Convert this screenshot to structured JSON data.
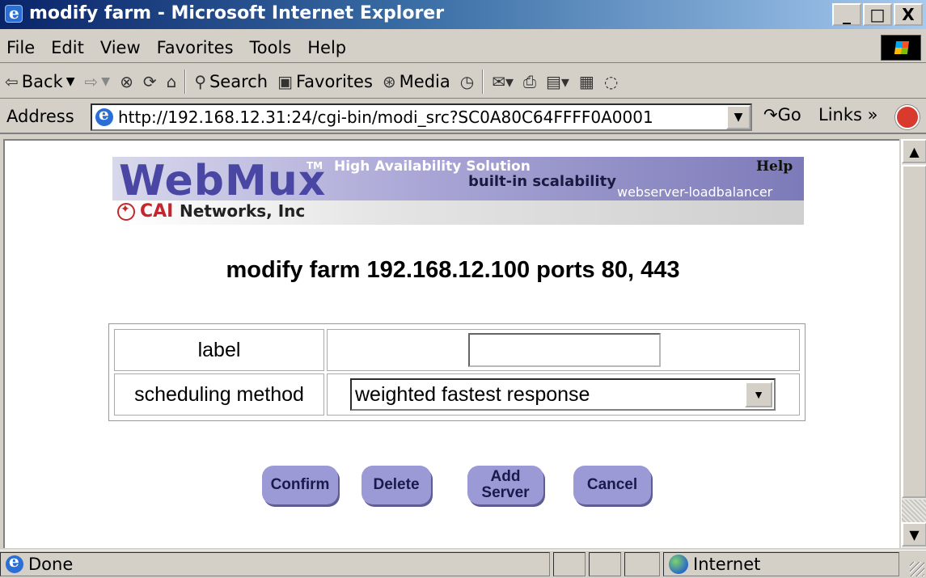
{
  "window": {
    "title": "modify farm - Microsoft Internet Explorer",
    "controls": {
      "minimize": "_",
      "maximize": "□",
      "close": "X"
    }
  },
  "menu": [
    "File",
    "Edit",
    "View",
    "Favorites",
    "Tools",
    "Help"
  ],
  "toolbar": {
    "back": "Back",
    "search": "Search",
    "favorites": "Favorites",
    "media": "Media"
  },
  "address": {
    "label": "Address",
    "url": "http://192.168.12.31:24/cgi-bin/modi_src?SC0A80C64FFFF0A0001",
    "go": "Go",
    "links": "Links"
  },
  "banner": {
    "product": "WebMux",
    "tm": "TM",
    "tagline1": "High Availability Solution",
    "tagline2": "built-in scalability",
    "tagline3": "webserver-loadbalancer",
    "help": "Help",
    "company_brand": "CAI",
    "company_rest": "Networks, Inc"
  },
  "page": {
    "heading": "modify farm 192.168.12.100 ports 80, 443"
  },
  "form": {
    "label_field": {
      "label": "label",
      "value": ""
    },
    "scheduling": {
      "label": "scheduling method",
      "selected": "weighted fastest response"
    }
  },
  "buttons": {
    "confirm": "Confirm",
    "delete": "Delete",
    "add_server_line1": "Add",
    "add_server_line2": "Server",
    "cancel": "Cancel"
  },
  "status": {
    "text": "Done",
    "zone": "Internet"
  },
  "colors": {
    "titlebar": "#0a246a",
    "button_fill": "#9b99d6",
    "webmux_text": "#4a46a3",
    "cai_red": "#c2272d"
  }
}
